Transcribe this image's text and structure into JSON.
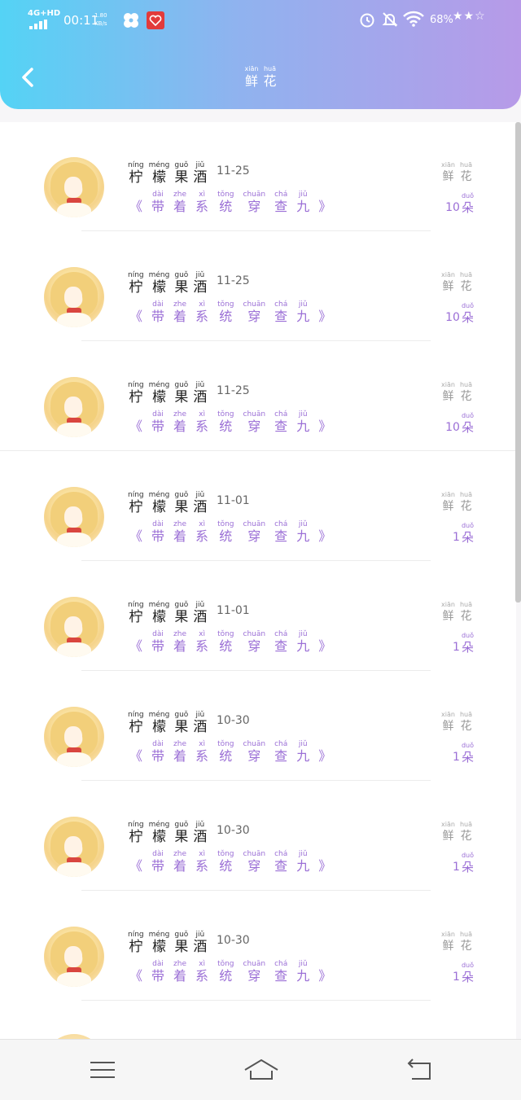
{
  "status_bar": {
    "network": "4G+HD",
    "time": "00:11",
    "speed_value": "1.80",
    "speed_unit": "KB/s",
    "battery": "68%",
    "decor": "★★☆"
  },
  "header": {
    "back_icon": "chevron-left-icon",
    "title": [
      {
        "pinyin": "xiān",
        "char": "鲜"
      },
      {
        "pinyin": "huā",
        "char": "花"
      }
    ]
  },
  "labels": {
    "flower": [
      {
        "pinyin": "xiān",
        "char": "鲜"
      },
      {
        "pinyin": "huā",
        "char": "花"
      }
    ],
    "unit": {
      "pinyin": "duǒ",
      "char": "朵"
    }
  },
  "records": [
    {
      "name": [
        {
          "pinyin": "níng",
          "char": "柠"
        },
        {
          "pinyin": "méng",
          "char": "檬"
        },
        {
          "pinyin": "guǒ",
          "char": "果"
        },
        {
          "pinyin": "jiǔ",
          "char": "酒"
        }
      ],
      "date": "11-25",
      "gift_open": "《",
      "gift": [
        {
          "pinyin": "dài",
          "char": "带"
        },
        {
          "pinyin": "zhe",
          "char": "着"
        },
        {
          "pinyin": "xì",
          "char": "系"
        },
        {
          "pinyin": "tǒng",
          "char": "统"
        },
        {
          "pinyin": "chuān",
          "char": "穿"
        },
        {
          "pinyin": "chá",
          "char": "查"
        },
        {
          "pinyin": "jiǔ",
          "char": "九"
        }
      ],
      "gift_close": "》",
      "count": "10"
    },
    {
      "name": [
        {
          "pinyin": "níng",
          "char": "柠"
        },
        {
          "pinyin": "méng",
          "char": "檬"
        },
        {
          "pinyin": "guǒ",
          "char": "果"
        },
        {
          "pinyin": "jiǔ",
          "char": "酒"
        }
      ],
      "date": "11-25",
      "gift_open": "《",
      "gift": [
        {
          "pinyin": "dài",
          "char": "带"
        },
        {
          "pinyin": "zhe",
          "char": "着"
        },
        {
          "pinyin": "xì",
          "char": "系"
        },
        {
          "pinyin": "tǒng",
          "char": "统"
        },
        {
          "pinyin": "chuān",
          "char": "穿"
        },
        {
          "pinyin": "chá",
          "char": "查"
        },
        {
          "pinyin": "jiǔ",
          "char": "九"
        }
      ],
      "gift_close": "》",
      "count": "10"
    },
    {
      "name": [
        {
          "pinyin": "níng",
          "char": "柠"
        },
        {
          "pinyin": "méng",
          "char": "檬"
        },
        {
          "pinyin": "guǒ",
          "char": "果"
        },
        {
          "pinyin": "jiǔ",
          "char": "酒"
        }
      ],
      "date": "11-25",
      "gift_open": "《",
      "gift": [
        {
          "pinyin": "dài",
          "char": "带"
        },
        {
          "pinyin": "zhe",
          "char": "着"
        },
        {
          "pinyin": "xì",
          "char": "系"
        },
        {
          "pinyin": "tǒng",
          "char": "统"
        },
        {
          "pinyin": "chuān",
          "char": "穿"
        },
        {
          "pinyin": "chá",
          "char": "查"
        },
        {
          "pinyin": "jiǔ",
          "char": "九"
        }
      ],
      "gift_close": "》",
      "count": "10"
    },
    {
      "name": [
        {
          "pinyin": "níng",
          "char": "柠"
        },
        {
          "pinyin": "méng",
          "char": "檬"
        },
        {
          "pinyin": "guǒ",
          "char": "果"
        },
        {
          "pinyin": "jiǔ",
          "char": "酒"
        }
      ],
      "date": "11-01",
      "gift_open": "《",
      "gift": [
        {
          "pinyin": "dài",
          "char": "带"
        },
        {
          "pinyin": "zhe",
          "char": "着"
        },
        {
          "pinyin": "xì",
          "char": "系"
        },
        {
          "pinyin": "tǒng",
          "char": "统"
        },
        {
          "pinyin": "chuān",
          "char": "穿"
        },
        {
          "pinyin": "chá",
          "char": "查"
        },
        {
          "pinyin": "jiǔ",
          "char": "九"
        }
      ],
      "gift_close": "》",
      "count": "1"
    },
    {
      "name": [
        {
          "pinyin": "níng",
          "char": "柠"
        },
        {
          "pinyin": "méng",
          "char": "檬"
        },
        {
          "pinyin": "guǒ",
          "char": "果"
        },
        {
          "pinyin": "jiǔ",
          "char": "酒"
        }
      ],
      "date": "11-01",
      "gift_open": "《",
      "gift": [
        {
          "pinyin": "dài",
          "char": "带"
        },
        {
          "pinyin": "zhe",
          "char": "着"
        },
        {
          "pinyin": "xì",
          "char": "系"
        },
        {
          "pinyin": "tǒng",
          "char": "统"
        },
        {
          "pinyin": "chuān",
          "char": "穿"
        },
        {
          "pinyin": "chá",
          "char": "查"
        },
        {
          "pinyin": "jiǔ",
          "char": "九"
        }
      ],
      "gift_close": "》",
      "count": "1"
    },
    {
      "name": [
        {
          "pinyin": "níng",
          "char": "柠"
        },
        {
          "pinyin": "méng",
          "char": "檬"
        },
        {
          "pinyin": "guǒ",
          "char": "果"
        },
        {
          "pinyin": "jiǔ",
          "char": "酒"
        }
      ],
      "date": "10-30",
      "gift_open": "《",
      "gift": [
        {
          "pinyin": "dài",
          "char": "带"
        },
        {
          "pinyin": "zhe",
          "char": "着"
        },
        {
          "pinyin": "xì",
          "char": "系"
        },
        {
          "pinyin": "tǒng",
          "char": "统"
        },
        {
          "pinyin": "chuān",
          "char": "穿"
        },
        {
          "pinyin": "chá",
          "char": "查"
        },
        {
          "pinyin": "jiǔ",
          "char": "九"
        }
      ],
      "gift_close": "》",
      "count": "1"
    },
    {
      "name": [
        {
          "pinyin": "níng",
          "char": "柠"
        },
        {
          "pinyin": "méng",
          "char": "檬"
        },
        {
          "pinyin": "guǒ",
          "char": "果"
        },
        {
          "pinyin": "jiǔ",
          "char": "酒"
        }
      ],
      "date": "10-30",
      "gift_open": "《",
      "gift": [
        {
          "pinyin": "dài",
          "char": "带"
        },
        {
          "pinyin": "zhe",
          "char": "着"
        },
        {
          "pinyin": "xì",
          "char": "系"
        },
        {
          "pinyin": "tǒng",
          "char": "统"
        },
        {
          "pinyin": "chuān",
          "char": "穿"
        },
        {
          "pinyin": "chá",
          "char": "查"
        },
        {
          "pinyin": "jiǔ",
          "char": "九"
        }
      ],
      "gift_close": "》",
      "count": "1"
    },
    {
      "name": [
        {
          "pinyin": "níng",
          "char": "柠"
        },
        {
          "pinyin": "méng",
          "char": "檬"
        },
        {
          "pinyin": "guǒ",
          "char": "果"
        },
        {
          "pinyin": "jiǔ",
          "char": "酒"
        }
      ],
      "date": "10-30",
      "gift_open": "《",
      "gift": [
        {
          "pinyin": "dài",
          "char": "带"
        },
        {
          "pinyin": "zhe",
          "char": "着"
        },
        {
          "pinyin": "xì",
          "char": "系"
        },
        {
          "pinyin": "tǒng",
          "char": "统"
        },
        {
          "pinyin": "chuān",
          "char": "穿"
        },
        {
          "pinyin": "chá",
          "char": "查"
        },
        {
          "pinyin": "jiǔ",
          "char": "九"
        }
      ],
      "gift_close": "》",
      "count": "1"
    }
  ],
  "nav_bar": {
    "menu_icon": "menu-icon",
    "home_icon": "home-icon",
    "back_icon": "back-arrow-icon"
  },
  "colors": {
    "header_start": "#54d3f5",
    "header_end": "#b79ae8",
    "accent": "#9b6fd6"
  }
}
